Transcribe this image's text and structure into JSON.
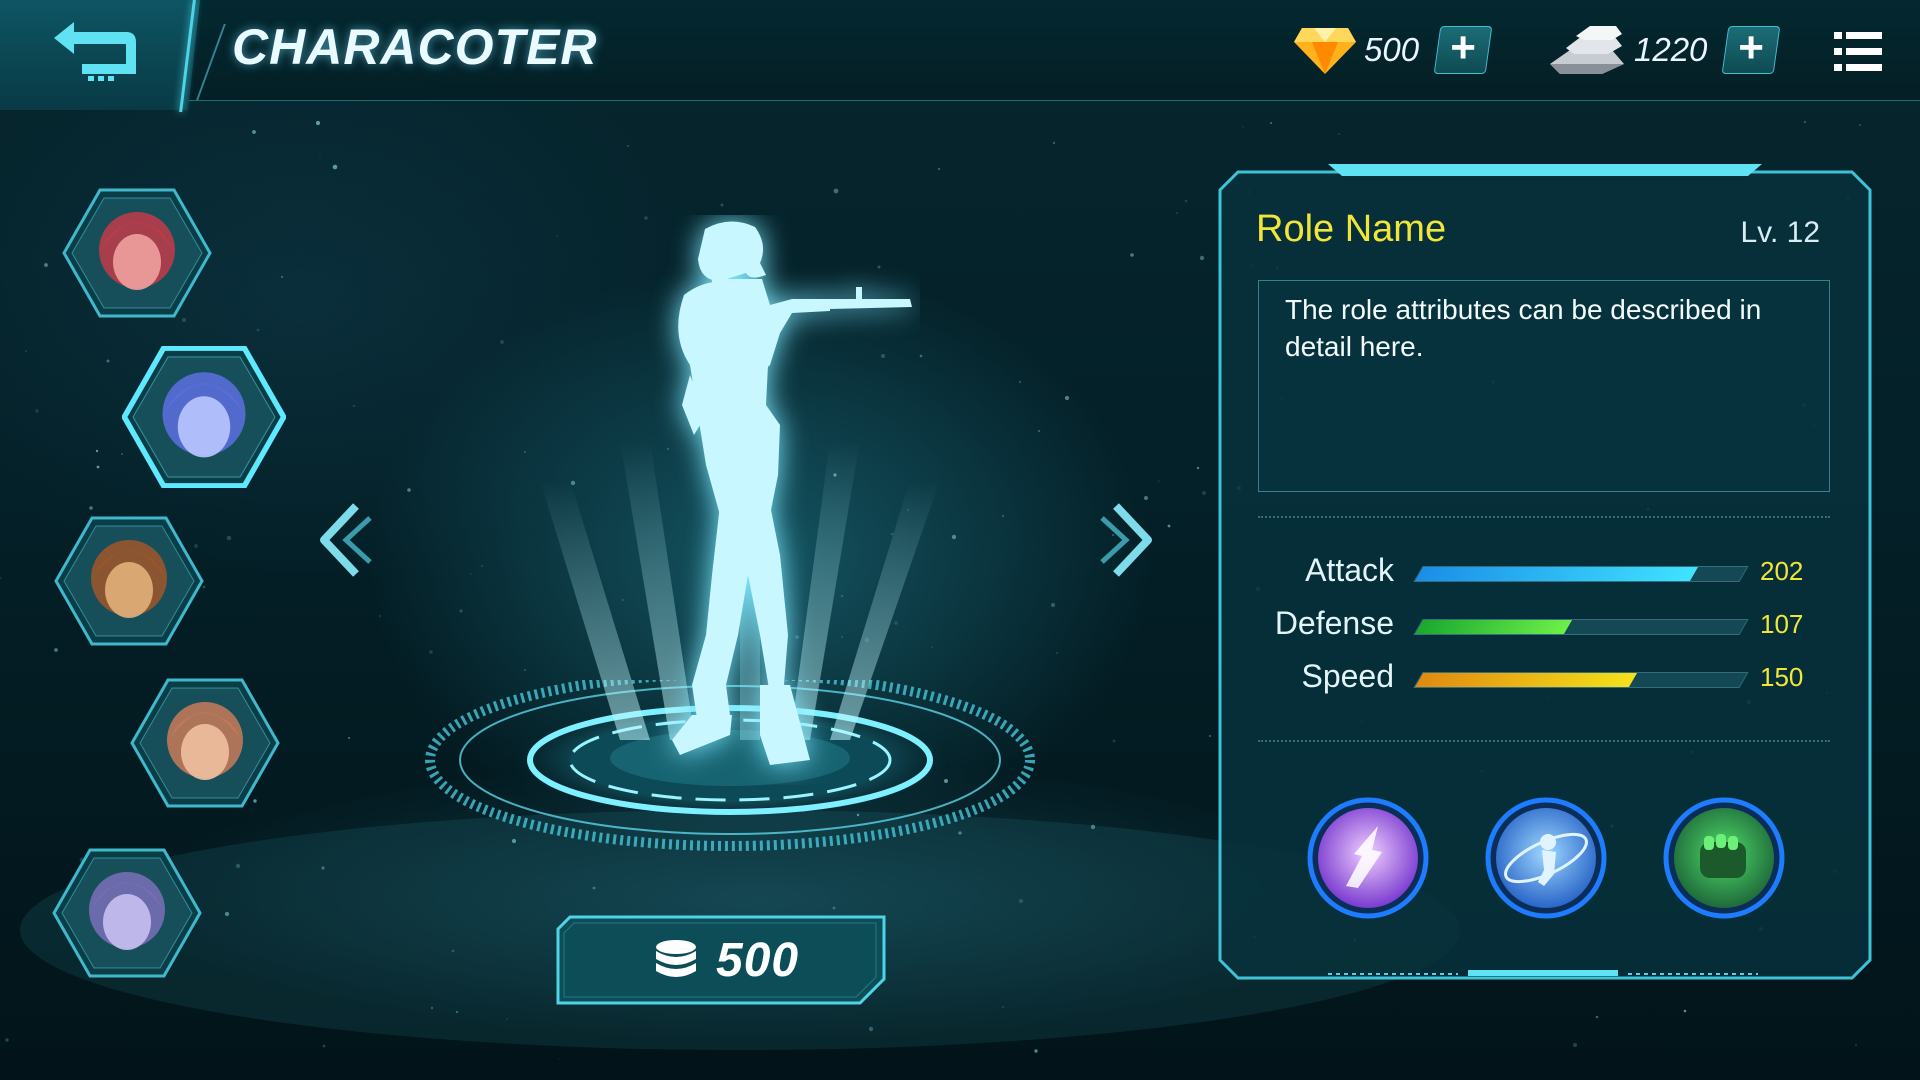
{
  "header": {
    "title": "CHARACOTER",
    "back_icon": "back-arrow-icon",
    "menu_icon": "menu-list-icon"
  },
  "currency": {
    "gems": {
      "icon": "diamond-icon",
      "value": "500",
      "add_label": "+"
    },
    "silver": {
      "icon": "silver-bar-icon",
      "value": "1220",
      "add_label": "+"
    }
  },
  "characters": [
    {
      "icon": "character-portrait-red-hair",
      "selected": false
    },
    {
      "icon": "character-portrait-blue-hair",
      "selected": true
    },
    {
      "icon": "character-portrait-monkey-king",
      "selected": false
    },
    {
      "icon": "character-portrait-spiky-hair",
      "selected": false
    },
    {
      "icon": "character-portrait-purple-hair",
      "selected": false
    }
  ],
  "stage": {
    "prev_icon": "chevron-left-icon",
    "next_icon": "chevron-right-icon",
    "figure_icon": "soldier-silhouette-icon"
  },
  "purchase": {
    "icon": "coin-stack-icon",
    "price": "500"
  },
  "role": {
    "name": "Role Name",
    "level": "Lv. 12",
    "description": "The role attributes can be described in detail here.",
    "stats": [
      {
        "label": "Attack",
        "value": "202",
        "fraction": 0.85,
        "color_from": "#1a8ee8",
        "color_to": "#3fe3ff"
      },
      {
        "label": "Defense",
        "value": "107",
        "fraction": 0.46,
        "color_from": "#1aa82e",
        "color_to": "#6ef04a"
      },
      {
        "label": "Speed",
        "value": "150",
        "fraction": 0.66,
        "color_from": "#e08a10",
        "color_to": "#f5e21a"
      }
    ],
    "skills": [
      {
        "icon": "lightning-strike-skill-icon"
      },
      {
        "icon": "orbit-runner-skill-icon"
      },
      {
        "icon": "fist-skill-icon"
      }
    ]
  },
  "colors": {
    "accent": "#3fd0e6",
    "gold": "#f2e53a",
    "panel_bg": "#07313b"
  }
}
